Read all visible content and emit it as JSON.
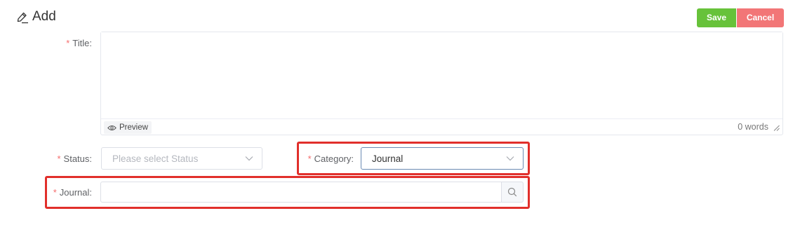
{
  "header": {
    "title": "Add",
    "icon": "edit-icon"
  },
  "toolbar": {
    "save_label": "Save",
    "cancel_label": "Cancel",
    "save_color": "#67c23a",
    "cancel_color": "#f27677"
  },
  "form": {
    "required_mark": "*",
    "title": {
      "label": "Title:",
      "value": "",
      "preview_label": "Preview",
      "word_count": "0 words"
    },
    "status": {
      "label": "Status:",
      "placeholder": "Please select Status"
    },
    "category": {
      "label": "Category:",
      "value": "Journal"
    },
    "journal": {
      "label": "Journal:",
      "value": ""
    }
  },
  "highlight_color": "#e12f2b"
}
